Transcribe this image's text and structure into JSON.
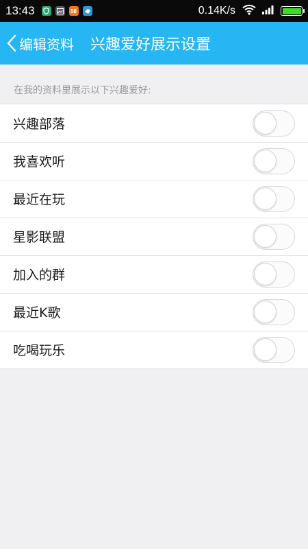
{
  "status_bar": {
    "time": "13:43",
    "network_speed": "0.14K/s",
    "app_icons": [
      {
        "name": "shield-app-icon",
        "text": "",
        "color": "#2aa876"
      },
      {
        "name": "gallery-app-icon",
        "text": "",
        "color": "#5a5a6a"
      },
      {
        "name": "58-app-icon",
        "text": "58",
        "color": "#f27a1a"
      },
      {
        "name": "bird-app-icon",
        "text": "",
        "color": "#2a9ad8"
      }
    ],
    "battery_level": 1.0
  },
  "title_bar": {
    "back_label": "编辑资料",
    "title": "兴趣爱好展示设置",
    "color": "#27b6f4"
  },
  "section_hint": "在我的资料里展示以下兴趣爱好:",
  "items": [
    {
      "label": "兴趣部落",
      "enabled": false
    },
    {
      "label": "我喜欢听",
      "enabled": false
    },
    {
      "label": "最近在玩",
      "enabled": false
    },
    {
      "label": "星影联盟",
      "enabled": false
    },
    {
      "label": "加入的群",
      "enabled": false
    },
    {
      "label": "最近K歌",
      "enabled": false
    },
    {
      "label": "吃喝玩乐",
      "enabled": false
    }
  ]
}
